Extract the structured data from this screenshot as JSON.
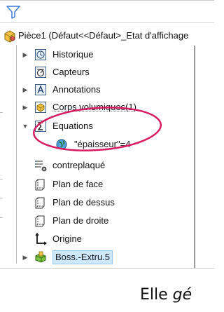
{
  "tree": {
    "root": {
      "label": "Pièce1  (Défaut<<Défaut>_Etat d'affichage"
    },
    "items": [
      {
        "label": "Historique",
        "icon": "history-icon",
        "expandable": true
      },
      {
        "label": "Capteurs",
        "icon": "sensors-icon",
        "expandable": false
      },
      {
        "label": "Annotations",
        "icon": "annotations-icon",
        "expandable": true
      },
      {
        "label": "Corps volumiques(1)",
        "icon": "solid-bodies-icon",
        "expandable": true
      },
      {
        "label": "Equations",
        "icon": "equations-icon",
        "expandable": true,
        "expanded": true
      },
      {
        "label": "\"épaisseur\"=4",
        "icon": "global-variable-icon",
        "child": true
      },
      {
        "label": "contreplaqué",
        "icon": "material-icon",
        "expandable": false
      },
      {
        "label": "Plan de face",
        "icon": "plane-icon",
        "expandable": false
      },
      {
        "label": "Plan de dessus",
        "icon": "plane-icon",
        "expandable": false
      },
      {
        "label": "Plan de droite",
        "icon": "plane-icon",
        "expandable": false
      },
      {
        "label": "Origine",
        "icon": "origin-icon",
        "expandable": false
      },
      {
        "label": "Boss.-Extru.5",
        "icon": "boss-extrude-icon",
        "expandable": true,
        "selected": true
      }
    ]
  },
  "caption": {
    "text_plain": "Elle ",
    "text_italic": "gé"
  },
  "colors": {
    "highlight_ellipse": "#d81b60",
    "selection": "#cde8ff"
  }
}
